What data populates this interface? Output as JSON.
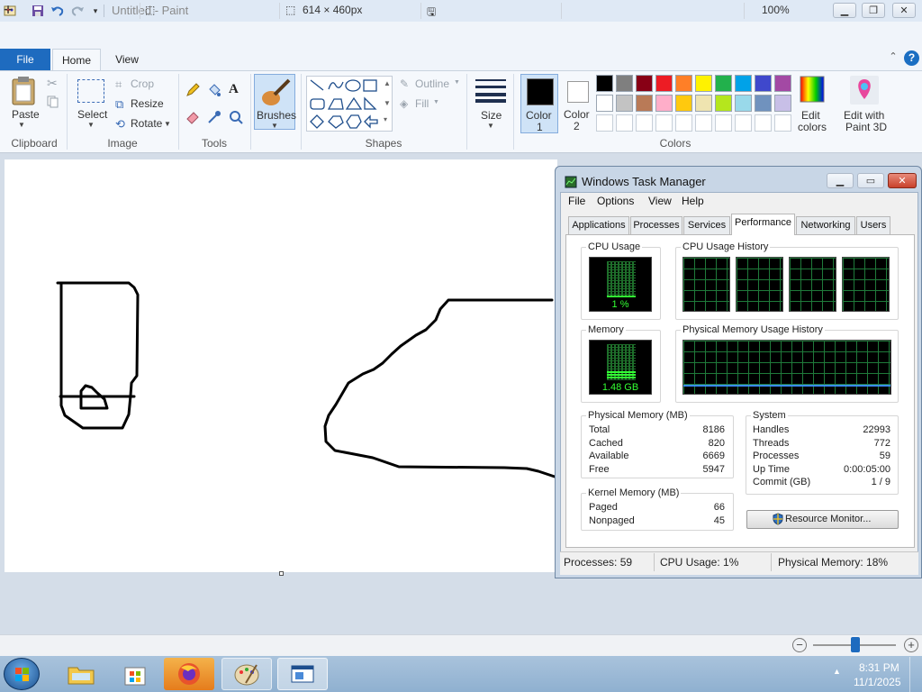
{
  "window": {
    "title": "Untitled - Paint"
  },
  "ribbon_tabs": {
    "file": "File",
    "home": "Home",
    "view": "View"
  },
  "clipboard": {
    "paste": "Paste",
    "group": "Clipboard"
  },
  "image": {
    "select": "Select",
    "crop": "Crop",
    "resize": "Resize",
    "rotate": "Rotate",
    "group": "Image"
  },
  "tools": {
    "group": "Tools"
  },
  "brushes": {
    "label": "Brushes"
  },
  "shapes": {
    "outline": "Outline",
    "fill": "Fill",
    "group": "Shapes"
  },
  "size": {
    "label": "Size"
  },
  "colors": {
    "color1": "Color",
    "color1_num": "1",
    "color2": "Color",
    "color2_num": "2",
    "edit": "Edit",
    "edit2": "colors",
    "paint3d": "Edit with",
    "paint3d2": "Paint 3D",
    "group": "Colors",
    "palette": [
      "#000000",
      "#7f7f7f",
      "#880015",
      "#ed1c24",
      "#ff7f27",
      "#fff200",
      "#22b14c",
      "#00a2e8",
      "#3f48cc",
      "#a349a4",
      "#ffffff",
      "#c3c3c3",
      "#b97a57",
      "#ffaec9",
      "#ffc90e",
      "#efe4b0",
      "#b5e61d",
      "#99d9ea",
      "#7092be",
      "#c8bfe7"
    ]
  },
  "status": {
    "dimensions": "614 × 460px",
    "zoom": "100%"
  },
  "taskbar": {
    "time": "8:31 PM",
    "date": "11/1/2025"
  },
  "taskmgr": {
    "title": "Windows Task Manager",
    "menu": [
      "File",
      "Options",
      "View",
      "Help"
    ],
    "tabs": [
      "Applications",
      "Processes",
      "Services",
      "Performance",
      "Networking",
      "Users"
    ],
    "cpu_usage_label": "CPU Usage",
    "cpu_value": "1 %",
    "cpu_history_label": "CPU Usage History",
    "memory_label": "Memory",
    "memory_value": "1.48 GB",
    "memory_history_label": "Physical Memory Usage History",
    "physical_memory": {
      "label": "Physical Memory (MB)",
      "rows": [
        {
          "name": "Total",
          "value": "8186"
        },
        {
          "name": "Cached",
          "value": "820"
        },
        {
          "name": "Available",
          "value": "6669"
        },
        {
          "name": "Free",
          "value": "5947"
        }
      ]
    },
    "system": {
      "label": "System",
      "rows": [
        {
          "name": "Handles",
          "value": "22993"
        },
        {
          "name": "Threads",
          "value": "772"
        },
        {
          "name": "Processes",
          "value": "59"
        },
        {
          "name": "Up Time",
          "value": "0:00:05:00"
        },
        {
          "name": "Commit (GB)",
          "value": "1 / 9"
        }
      ]
    },
    "kernel_memory": {
      "label": "Kernel Memory (MB)",
      "rows": [
        {
          "name": "Paged",
          "value": "66"
        },
        {
          "name": "Nonpaged",
          "value": "45"
        }
      ]
    },
    "resource_monitor": "Resource Monitor...",
    "status": {
      "processes": "Processes: 59",
      "cpu": "CPU Usage: 1%",
      "memory": "Physical Memory: 18%"
    }
  }
}
